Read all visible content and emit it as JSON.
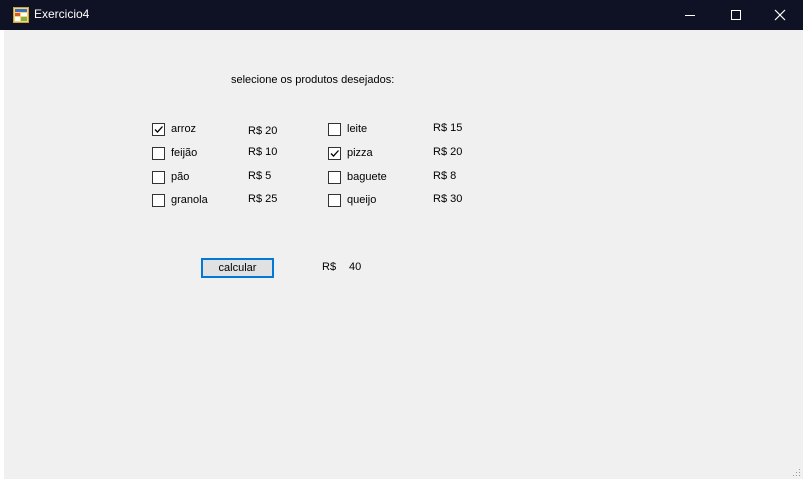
{
  "window": {
    "title": "Exercicio4"
  },
  "form": {
    "instruction": "selecione os produtos desejados:",
    "products": [
      {
        "name": "arroz",
        "price": "R$ 20",
        "checked": true
      },
      {
        "name": "feijão",
        "price": "R$ 10",
        "checked": false
      },
      {
        "name": "pão",
        "price": "R$ 5",
        "checked": false
      },
      {
        "name": "granola",
        "price": "R$ 25",
        "checked": false
      },
      {
        "name": "leite",
        "price": "R$ 15",
        "checked": false
      },
      {
        "name": "pizza",
        "price": "R$ 20",
        "checked": true
      },
      {
        "name": "baguete",
        "price": "R$ 8",
        "checked": false
      },
      {
        "name": "queijo",
        "price": "R$ 30",
        "checked": false
      }
    ],
    "calculate_label": "calcular",
    "total_prefix": "R$",
    "total_value": "40"
  },
  "colors": {
    "titlebar": "#0f1124",
    "client": "#f0f0f0",
    "accent": "#0078d7"
  }
}
